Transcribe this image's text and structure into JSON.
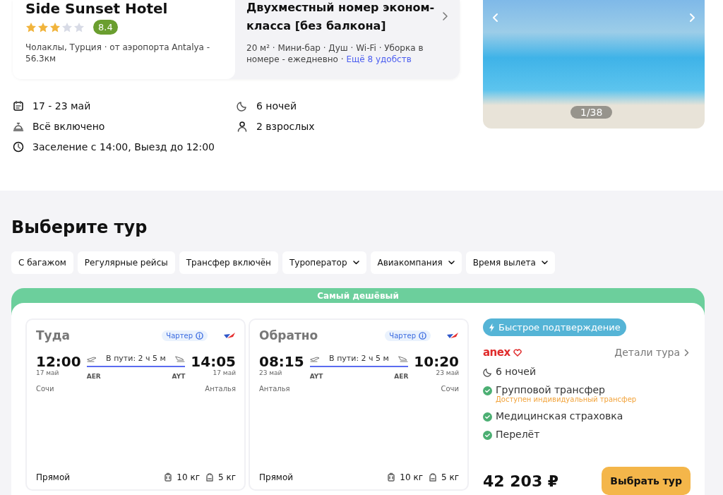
{
  "hotel": {
    "name": "Side Sunset Hotel",
    "stars": 3,
    "rating": "8.4",
    "location": "Чолаклы, Турция · от аэропорта Antalya - 56.3км"
  },
  "room": {
    "title": "Двухместный номер эконом-класса [без балкона]",
    "amenities": "20 м² · Мини-бар · Душ · Wi-Fi · Уборка в номере - ежедневно ·",
    "more_link": "Ещё 8 удобств"
  },
  "gallery": {
    "counter": "1/38"
  },
  "details": [
    {
      "kind": "dates",
      "text": "17 - 23 май"
    },
    {
      "kind": "nights",
      "text": "6 ночей"
    },
    {
      "kind": "meals",
      "text": "Всё включено"
    },
    {
      "kind": "guests",
      "text": "2 взрослых"
    },
    {
      "kind": "checkin",
      "text": "Заселение с 14:00, Выезд до 12:00"
    }
  ],
  "section_title": "Выберите тур",
  "filters": [
    {
      "label": "С багажом",
      "kind": "toggle"
    },
    {
      "label": "Регулярные рейсы",
      "kind": "toggle"
    },
    {
      "label": "Трансфер включён",
      "kind": "toggle"
    },
    {
      "label": "Туроператор",
      "kind": "dropdown"
    },
    {
      "label": "Авиакомпания",
      "kind": "dropdown"
    },
    {
      "label": "Время вылета",
      "kind": "dropdown"
    }
  ],
  "offer": {
    "ribbon": "Самый дешёвый",
    "flights": [
      {
        "title": "Туда",
        "tag": "Чартер",
        "dep_time": "12:00",
        "dep_date": "17 май",
        "dep_code": "AER",
        "dep_city": "Сочи",
        "duration": "В пути: 2 ч 5 м",
        "arr_time": "14:05",
        "arr_date": "17 май",
        "arr_code": "AYT",
        "arr_city": "Анталья",
        "stops": "Прямой",
        "baggage": "10 кг",
        "hand_luggage": "5 кг"
      },
      {
        "title": "Обратно",
        "tag": "Чартер",
        "dep_time": "08:15",
        "dep_date": "23 май",
        "dep_code": "AYT",
        "dep_city": "Анталья",
        "duration": "В пути: 2 ч 5 м",
        "arr_time": "10:20",
        "arr_date": "23 май",
        "arr_code": "AER",
        "arr_city": "Сочи",
        "stops": "Прямой",
        "baggage": "10 кг",
        "hand_luggage": "5 кг"
      }
    ],
    "badge": "Быстрое подтверждение",
    "operator": "anex",
    "details_link": "Детали тура",
    "features": [
      {
        "kind": "nights",
        "text": "6 ночей"
      },
      {
        "kind": "included",
        "text": "Групповой трансфер",
        "note": "Доступен индивидуальный трансфер"
      },
      {
        "kind": "included",
        "text": "Медицинская страховка"
      },
      {
        "kind": "included",
        "text": "Перелёт"
      }
    ],
    "price": "42 203 ₽",
    "button": "Выбрать тур"
  }
}
